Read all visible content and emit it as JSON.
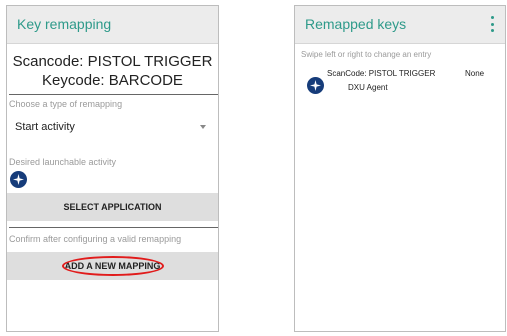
{
  "left_screen": {
    "title": "Key remapping",
    "scancode_label": "Scancode: PISTOL TRIGGER",
    "keycode_label": "Keycode: BARCODE",
    "choose_type_hint": "Choose a type of remapping",
    "remap_type_value": "Start activity",
    "desired_activity_hint": "Desired launchable activity",
    "activity_icon": "zebra-app-icon",
    "select_application_button": "SELECT APPLICATION",
    "confirm_hint": "Confirm after configuring a valid remapping",
    "add_mapping_button": "ADD A NEW MAPPING",
    "highlight_color": "#e11b1b"
  },
  "right_screen": {
    "title": "Remapped keys",
    "swipe_hint": "Swipe left or right to change an entry",
    "entries": [
      {
        "scancode": "ScanCode: PISTOL TRIGGER",
        "keycode": "None",
        "app": "DXU Agent",
        "icon": "zebra-app-icon"
      }
    ]
  },
  "colors": {
    "accent": "#2e9a8a",
    "appbar_bg": "#ececec",
    "button_bg": "#dedede",
    "icon_blue": "#163c7a"
  }
}
